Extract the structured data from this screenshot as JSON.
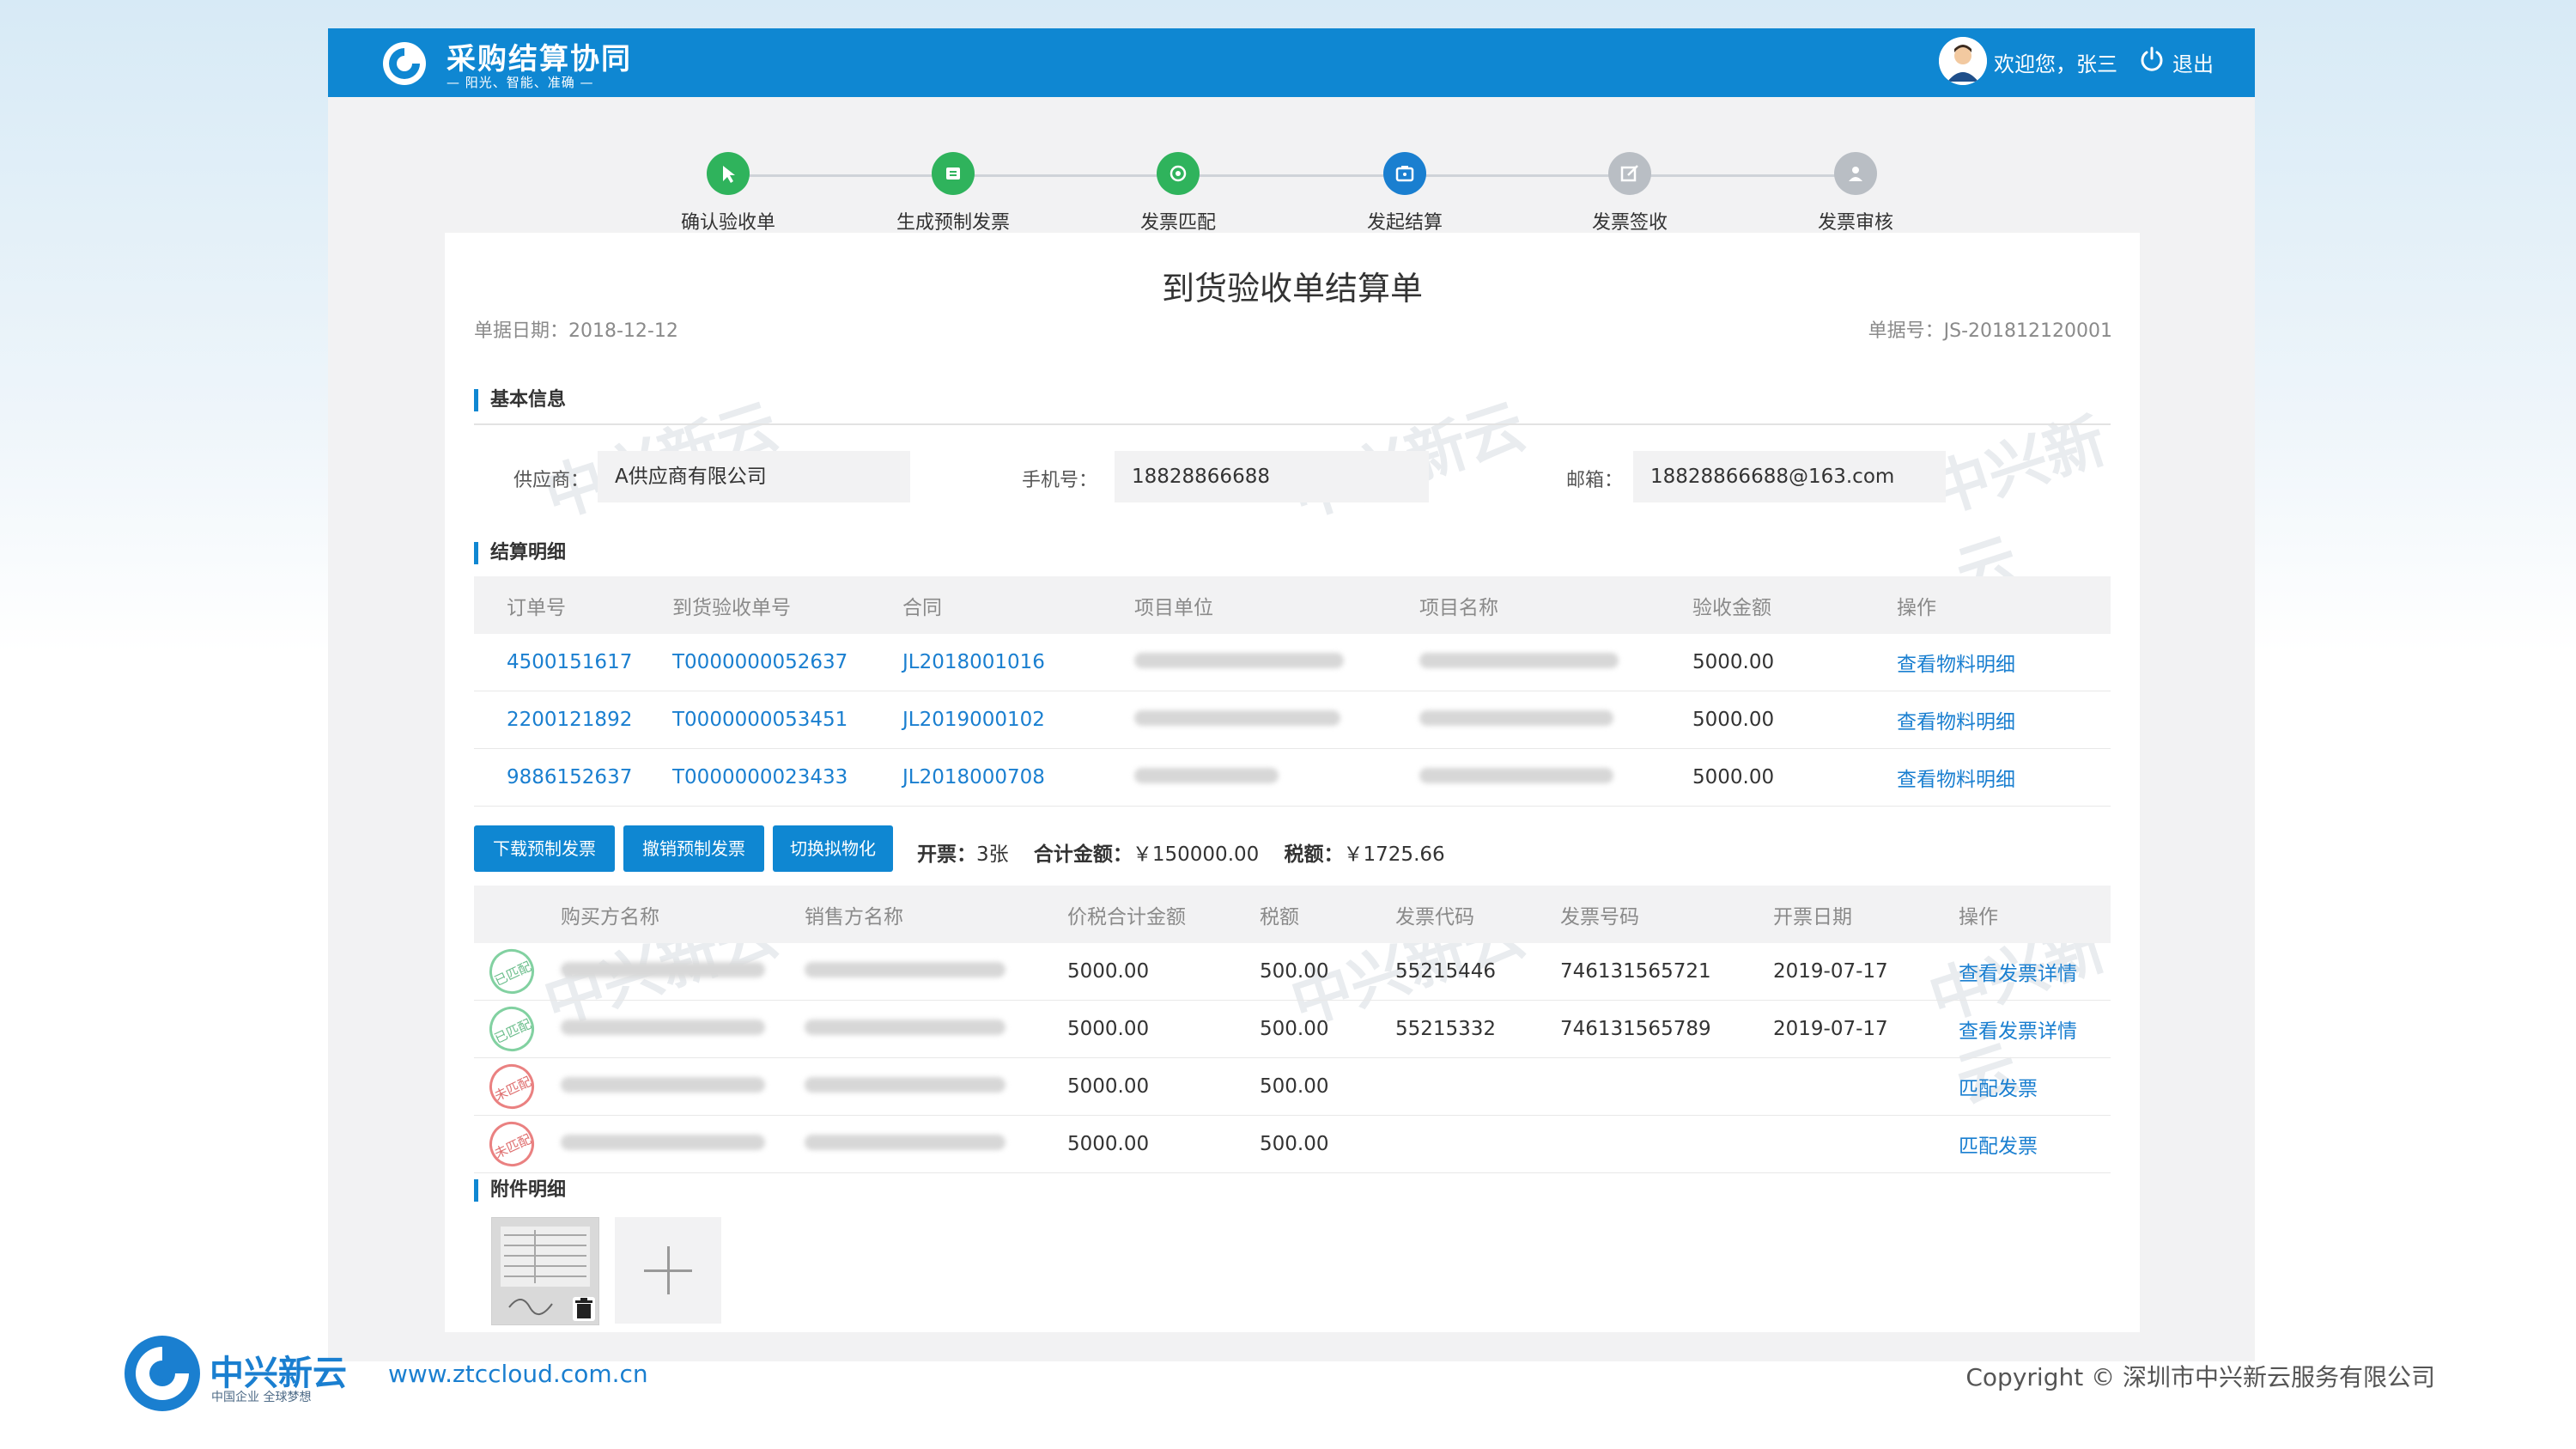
{
  "header": {
    "app_title": "采购结算协同",
    "app_slogan": "— 阳光、智能、准确 —",
    "welcome": "欢迎您，张三",
    "logout": "退出"
  },
  "steps": [
    {
      "label": "确认验收单",
      "color": "#2fb35c",
      "icon": "cursor-icon"
    },
    {
      "label": "生成预制发票",
      "color": "#2fb35c",
      "icon": "invoice-icon"
    },
    {
      "label": "发票匹配",
      "color": "#2fb35c",
      "icon": "target-icon"
    },
    {
      "label": "发起结算",
      "color": "#1a7fd0",
      "icon": "wallet-icon"
    },
    {
      "label": "发票签收",
      "color": "#b9bec4",
      "icon": "sign-icon"
    },
    {
      "label": "发票审核",
      "color": "#b9bec4",
      "icon": "user-check-icon"
    }
  ],
  "document": {
    "title": "到货验收单结算单",
    "date_label": "单据日期：2018-12-12",
    "number_label": "单据号：JS-201812120001"
  },
  "basic_info": {
    "section_title": "基本信息",
    "supplier_label": "供应商：",
    "supplier_value": "A供应商有限公司",
    "phone_label": "手机号：",
    "phone_value": "18828866688",
    "email_label": "邮箱：",
    "email_value": "18828866688@163.com"
  },
  "settlement": {
    "section_title": "结算明细",
    "columns": [
      "订单号",
      "到货验收单号",
      "合同",
      "项目单位",
      "项目名称",
      "验收金额",
      "操作"
    ],
    "rows": [
      {
        "order": "4500151617",
        "receipt": "T0000000052637",
        "contract": "JL2018001016",
        "amount": "5000.00",
        "action": "查看物料明细"
      },
      {
        "order": "2200121892",
        "receipt": "T0000000053451",
        "contract": "JL2019000102",
        "amount": "5000.00",
        "action": "查看物料明细"
      },
      {
        "order": "9886152637",
        "receipt": "T0000000023433",
        "contract": "JL2018000708",
        "amount": "5000.00",
        "action": "查看物料明细"
      }
    ]
  },
  "invoice_actions": {
    "download": "下载预制发票",
    "revoke": "撤销预制发票",
    "switch": "切换拟物化",
    "count_label": "开票：",
    "count_value": "3张",
    "total_label": "合计金额：",
    "total_value": "￥150000.00",
    "tax_label": "税额：",
    "tax_value": "￥1725.66"
  },
  "invoices": {
    "columns": [
      "购买方名称",
      "销售方名称",
      "价税合计金额",
      "税额",
      "发票代码",
      "发票号码",
      "开票日期",
      "操作"
    ],
    "rows": [
      {
        "stamp": "已匹配",
        "stamp_type": "matched",
        "total": "5000.00",
        "tax": "500.00",
        "code": "55215446",
        "number": "746131565721",
        "date": "2019-07-17",
        "action": "查看发票详情"
      },
      {
        "stamp": "已匹配",
        "stamp_type": "matched",
        "total": "5000.00",
        "tax": "500.00",
        "code": "55215332",
        "number": "746131565789",
        "date": "2019-07-17",
        "action": "查看发票详情"
      },
      {
        "stamp": "未匹配",
        "stamp_type": "unmatched",
        "total": "5000.00",
        "tax": "500.00",
        "code": "",
        "number": "",
        "date": "",
        "action": "匹配发票"
      },
      {
        "stamp": "未匹配",
        "stamp_type": "unmatched",
        "total": "5000.00",
        "tax": "500.00",
        "code": "",
        "number": "",
        "date": "",
        "action": "匹配发票"
      }
    ]
  },
  "attachments": {
    "section_title": "附件明细"
  },
  "watermark_text": "中兴新云",
  "footer": {
    "brand": "中兴新云",
    "brand_sub": "中国企业 全球梦想",
    "url": "www.ztccloud.com.cn",
    "copyright": "Copyright © 深圳市中兴新云服务有限公司"
  },
  "colors": {
    "brand_blue": "#0f87d2",
    "link_blue": "#1a7fd0",
    "step_done": "#2fb35c",
    "step_pending": "#b9bec4"
  }
}
